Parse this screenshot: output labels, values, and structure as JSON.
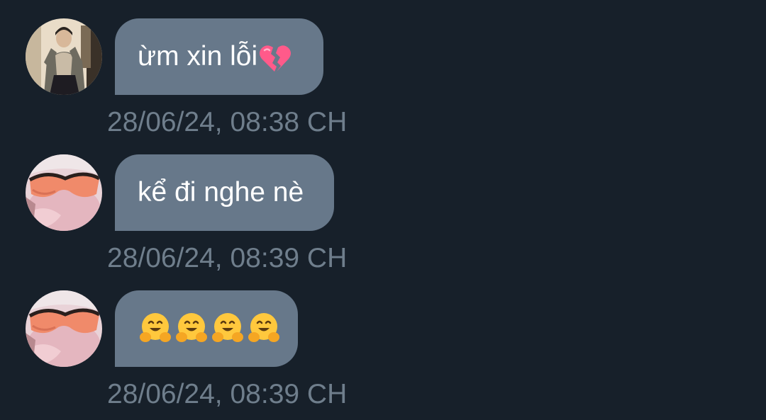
{
  "messages": [
    {
      "avatar": "avatar-man-in-jacket",
      "text": "ừm xin lỗi",
      "emoji": "broken-heart-icon",
      "timestamp": "28/06/24, 08:38 CH"
    },
    {
      "avatar": "avatar-person-orange-glasses",
      "text": "kể đi nghe nè",
      "timestamp": "28/06/24, 08:39 CH"
    },
    {
      "avatar": "avatar-person-orange-glasses",
      "text": "",
      "emoji": [
        "hugging-face-icon",
        "hugging-face-icon",
        "hugging-face-icon",
        "hugging-face-icon"
      ],
      "timestamp": "28/06/24, 08:39 CH"
    }
  ],
  "colors": {
    "background": "#17202a",
    "bubble": "#67788a",
    "timestamp": "#6f7e8c",
    "text": "#ffffff"
  }
}
